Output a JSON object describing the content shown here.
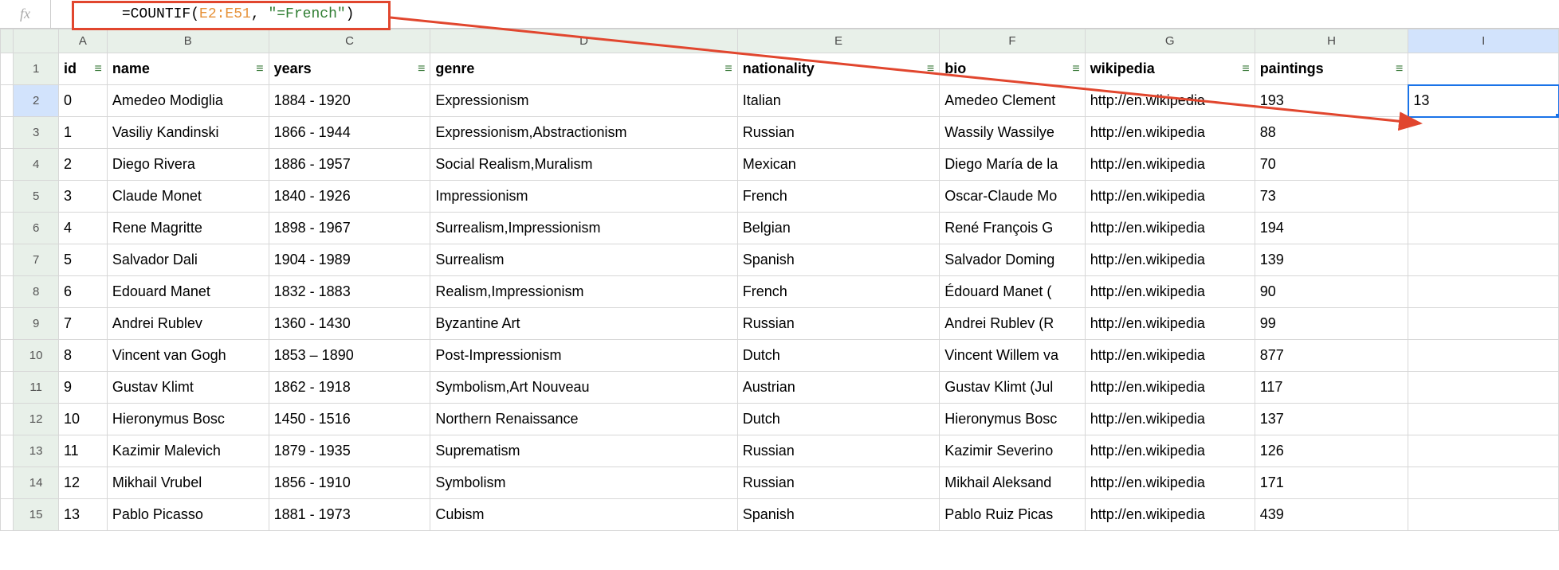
{
  "formula": {
    "prefix": "=COUNTIF(",
    "arg1": "E2:E51",
    "comma": ", ",
    "arg2": "\"=French\"",
    "suffix": ")"
  },
  "fx_label": "fx",
  "columns": [
    "A",
    "B",
    "C",
    "D",
    "E",
    "F",
    "G",
    "H",
    "I"
  ],
  "headers": {
    "A": "id",
    "B": "name",
    "C": "years",
    "D": "genre",
    "E": "nationality",
    "F": "bio",
    "G": "wikipedia",
    "H": "paintings",
    "I": ""
  },
  "rows": [
    {
      "n": "1"
    },
    {
      "n": "2",
      "A": "0",
      "B": "Amedeo Modiglia",
      "C": "1884 - 1920",
      "D": "Expressionism",
      "E": "Italian",
      "F": "Amedeo Clement",
      "G": "http://en.wikipedia",
      "H": "193",
      "I": "13"
    },
    {
      "n": "3",
      "A": "1",
      "B": "Vasiliy Kandinski",
      "C": "1866 - 1944",
      "D": "Expressionism,Abstractionism",
      "E": "Russian",
      "F": "Wassily Wassilye",
      "G": "http://en.wikipedia",
      "H": "88",
      "I": ""
    },
    {
      "n": "4",
      "A": "2",
      "B": "Diego Rivera",
      "C": "1886 - 1957",
      "D": "Social Realism,Muralism",
      "E": "Mexican",
      "F": "Diego María de la",
      "G": "http://en.wikipedia",
      "H": "70",
      "I": ""
    },
    {
      "n": "5",
      "A": "3",
      "B": "Claude Monet",
      "C": "1840 - 1926",
      "D": "Impressionism",
      "E": "French",
      "F": "Oscar-Claude Mo",
      "G": "http://en.wikipedia",
      "H": "73",
      "I": ""
    },
    {
      "n": "6",
      "A": "4",
      "B": "Rene Magritte",
      "C": "1898 - 1967",
      "D": "Surrealism,Impressionism",
      "E": "Belgian",
      "F": "René François G",
      "G": "http://en.wikipedia",
      "H": "194",
      "I": ""
    },
    {
      "n": "7",
      "A": "5",
      "B": "Salvador Dali",
      "C": "1904 - 1989",
      "D": "Surrealism",
      "E": "Spanish",
      "F": "Salvador Doming",
      "G": "http://en.wikipedia",
      "H": "139",
      "I": ""
    },
    {
      "n": "8",
      "A": "6",
      "B": "Edouard Manet",
      "C": "1832 - 1883",
      "D": "Realism,Impressionism",
      "E": "French",
      "F": "Édouard Manet (",
      "G": "http://en.wikipedia",
      "H": "90",
      "I": ""
    },
    {
      "n": "9",
      "A": "7",
      "B": "Andrei Rublev",
      "C": "1360 - 1430",
      "D": "Byzantine Art",
      "E": "Russian",
      "F": "Andrei Rublev (R",
      "G": "http://en.wikipedia",
      "H": "99",
      "I": ""
    },
    {
      "n": "10",
      "A": "8",
      "B": "Vincent van Gogh",
      "C": "1853 – 1890",
      "D": "Post-Impressionism",
      "E": "Dutch",
      "F": "Vincent Willem va",
      "G": "http://en.wikipedia",
      "H": "877",
      "I": ""
    },
    {
      "n": "11",
      "A": "9",
      "B": "Gustav Klimt",
      "C": "1862 - 1918",
      "D": "Symbolism,Art Nouveau",
      "E": "Austrian",
      "F": "Gustav Klimt (Jul",
      "G": "http://en.wikipedia",
      "H": "117",
      "I": ""
    },
    {
      "n": "12",
      "A": "10",
      "B": "Hieronymus Bosc",
      "C": "1450 - 1516",
      "D": "Northern Renaissance",
      "E": "Dutch",
      "F": "Hieronymus Bosc",
      "G": "http://en.wikipedia",
      "H": "137",
      "I": ""
    },
    {
      "n": "13",
      "A": "11",
      "B": "Kazimir Malevich",
      "C": "1879 - 1935",
      "D": "Suprematism",
      "E": "Russian",
      "F": "Kazimir Severino",
      "G": "http://en.wikipedia",
      "H": "126",
      "I": ""
    },
    {
      "n": "14",
      "A": "12",
      "B": "Mikhail Vrubel",
      "C": "1856 - 1910",
      "D": "Symbolism",
      "E": "Russian",
      "F": "Mikhail Aleksand",
      "G": "http://en.wikipedia",
      "H": "171",
      "I": ""
    },
    {
      "n": "15",
      "A": "13",
      "B": "Pablo Picasso",
      "C": "1881 - 1973",
      "D": "Cubism",
      "E": "Spanish",
      "F": "Pablo Ruiz Picas",
      "G": "http://en.wikipedia",
      "H": "439",
      "I": ""
    }
  ],
  "filter_glyph": "⏷",
  "annotation": {
    "highlight_color": "#e1462e",
    "active_cell_color": "#1a73e8"
  }
}
